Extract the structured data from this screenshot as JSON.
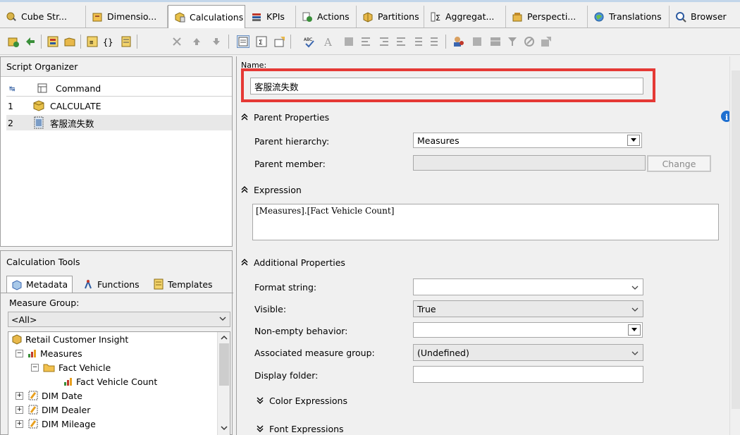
{
  "tabs": [
    {
      "label": "Cube Str...",
      "icon": "cube-structure-icon"
    },
    {
      "label": "Dimensio...",
      "icon": "dimensions-icon"
    },
    {
      "label": "Calculations",
      "icon": "calculations-icon",
      "active": true
    },
    {
      "label": "KPIs",
      "icon": "kpis-icon"
    },
    {
      "label": "Actions",
      "icon": "actions-icon"
    },
    {
      "label": "Partitions",
      "icon": "partitions-icon"
    },
    {
      "label": "Aggregat...",
      "icon": "aggregations-icon"
    },
    {
      "label": "Perspecti...",
      "icon": "perspectives-icon"
    },
    {
      "label": "Translations",
      "icon": "translations-icon"
    },
    {
      "label": "Browser",
      "icon": "browser-icon"
    }
  ],
  "script_organizer": {
    "title": "Script Organizer",
    "column_header": "Command",
    "rows": [
      {
        "num": "1",
        "label": "CALCULATE"
      },
      {
        "num": "2",
        "label": "客服流失数"
      }
    ]
  },
  "calc_tools": {
    "title": "Calculation Tools",
    "tabs": [
      "Metadata",
      "Functions",
      "Templates"
    ],
    "measure_group_label": "Measure Group:",
    "measure_group_value": "<All>",
    "tree": [
      "Retail Customer Insight",
      "Measures",
      "Fact Vehicle",
      "Fact Vehicle Count",
      "DIM Date",
      "DIM Dealer",
      "DIM Mileage"
    ]
  },
  "form": {
    "name_label": "Name:",
    "name_value": "客服流失数",
    "parent_properties": "Parent Properties",
    "parent_hierarchy_label": "Parent hierarchy:",
    "parent_hierarchy_value": "Measures",
    "parent_member_label": "Parent member:",
    "change_button": "Change",
    "expression_header": "Expression",
    "expression_value": "[Measures].[Fact Vehicle Count]",
    "additional_properties": "Additional Properties",
    "format_string_label": "Format string:",
    "format_string_value": "",
    "visible_label": "Visible:",
    "visible_value": "True",
    "non_empty_label": "Non-empty behavior:",
    "non_empty_value": "",
    "assoc_group_label": "Associated measure group:",
    "assoc_group_value": "(Undefined)",
    "display_folder_label": "Display folder:",
    "display_folder_value": "",
    "color_expressions": "Color Expressions",
    "font_expressions": "Font Expressions"
  },
  "colors": {
    "highlight_border": "#e53935",
    "info_icon": "#1e6fd0"
  }
}
